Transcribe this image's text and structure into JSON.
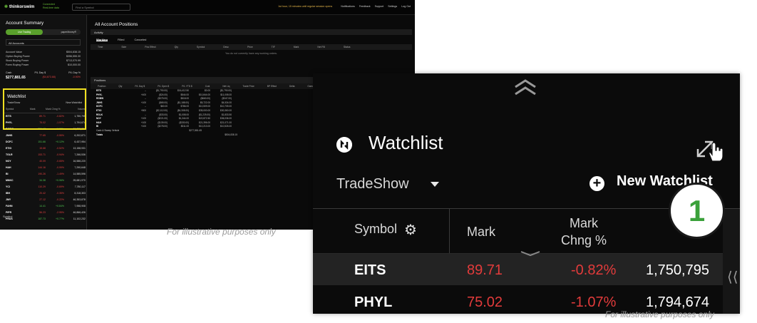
{
  "app": {
    "logo": "thinkorswim",
    "connection_line1": "Connected",
    "connection_line2": "Real-time data",
    "find_symbol_placeholder": "Find a Symbol",
    "top_warning": "1st hour, 15 minutes until regular session opens",
    "top_links": [
      "Notifications",
      "Feedback",
      "Support",
      "Settings",
      "Log Out"
    ]
  },
  "account_summary": {
    "title": "Account Summary",
    "toggle_on": "Live Trading",
    "toggle_off": "paperMoney®",
    "account_select": "All Accounts",
    "rows": [
      {
        "label": "Account Value",
        "value": "$504,838.15"
      },
      {
        "label": "Option Buying Power",
        "value": "$356,555.30"
      },
      {
        "label": "Stock Buying Power",
        "value": "$713,070.99"
      },
      {
        "label": "Forex Buying Power",
        "value": "$10,000.00"
      }
    ],
    "cash_label": "Cash",
    "cash_value": "$277,881.65",
    "pl_day_label": "P/L Day $",
    "pl_day_value": "($4,673.68)",
    "pl_day_pct_label": "P/L Day %",
    "pl_day_pct_value": "-0.90%"
  },
  "watchlist_small": {
    "title": "Watchlist",
    "list_name": "TradeShow",
    "new_watchlist": "New Watchlist",
    "columns": [
      "Symbol",
      "Mark",
      "Mark Chng %",
      "Volume"
    ],
    "rows": [
      {
        "symbol": "EITS",
        "mark": "89.71",
        "chg": "-0.82%",
        "vol": "1,750,795",
        "dir": "down"
      },
      {
        "symbol": "PHYL",
        "mark": "75.02",
        "chg": "-1.07%",
        "vol": "1,794,674",
        "dir": "down"
      },
      {
        "symbol": "RGBW",
        "mark": "256.17",
        "chg": "+0.33%",
        "vol": "10,833,884",
        "dir": "up"
      },
      {
        "symbol": "JNHS",
        "mark": "77.65",
        "chg": "-0.55%",
        "vol": "6,202,871",
        "dir": "down"
      },
      {
        "symbol": "DCFC",
        "mark": "151.66",
        "chg": "+0.12%",
        "vol": "6,437,954",
        "dir": "up"
      },
      {
        "symbol": "ETIO",
        "mark": "15.68",
        "chg": "-0.52%",
        "vol": "13,158,931",
        "dir": "down"
      },
      {
        "symbol": "TGLR",
        "mark": "153.71",
        "chg": "-0.94%",
        "vol": "7,266,536",
        "dir": "down"
      },
      {
        "symbol": "NOY",
        "mark": "40.09",
        "chg": "-0.65%",
        "vol": "16,588,220",
        "dir": "down"
      },
      {
        "symbol": "HAH",
        "mark": "144.16",
        "chg": "-0.99%",
        "vol": "7,290,648",
        "dir": "down"
      },
      {
        "symbol": "BI",
        "mark": "190.26",
        "chg": "-1.49%",
        "vol": "14,585,596",
        "dir": "down"
      },
      {
        "symbol": "MNKC",
        "mark": "34.38",
        "chg": "+0.96%",
        "vol": "25,681,970",
        "dir": "up"
      },
      {
        "symbol": "YCI",
        "mark": "110.29",
        "chg": "-0.69%",
        "vol": "7,780,117",
        "dir": "down"
      },
      {
        "symbol": "IBH",
        "mark": "20.42",
        "chg": "-0.35%",
        "vol": "8,318,303",
        "dir": "down"
      },
      {
        "symbol": "JMY",
        "mark": "27.12",
        "chg": "-0.22%",
        "vol": "46,353,878",
        "dir": "down"
      },
      {
        "symbol": "FAHN",
        "mark": "14.41",
        "chg": "+0.84%",
        "vol": "7,958,908",
        "dir": "up"
      },
      {
        "symbol": "PIPR",
        "mark": "56.23",
        "chg": "-2.95%",
        "vol": "46,866,426",
        "dir": "down"
      },
      {
        "symbol": "PRUS",
        "mark": "187.73",
        "chg": "+0.77%",
        "vol": "11,102,232",
        "dir": "up"
      }
    ],
    "footer": "Symbol"
  },
  "positions_pane": {
    "title": "All Account Positions",
    "activity_label": "Activity",
    "tabs": [
      "Working",
      "Filled",
      "Canceled"
    ],
    "order_columns": [
      "Time",
      "Side",
      "Pos Effect",
      "Qty",
      "Symbol",
      "Desc",
      "Price",
      "TIF",
      "Mark",
      "Net Fill",
      "Status"
    ],
    "no_orders": "You do not currently have any working orders.",
    "positions_label": "Positions",
    "position_columns": [
      "Position",
      "Qty",
      "P/L Day $",
      "P/L Open $",
      "P/L YTD $",
      "Cost",
      "Net Liq",
      "Trade Price",
      "BP Effect",
      "Delta",
      "Gamma",
      "Theta",
      "Vega"
    ],
    "positions": [
      {
        "symbol": "EITS",
        "qty": "--",
        "pl_day": "($1,790.00)",
        "pl_open": "$16,412.50",
        "cost": "$0.00",
        "net_liq": "($1,790.00)"
      },
      {
        "symbol": "PHYL",
        "qty": "+400",
        "pl_day": "($24.00)",
        "pl_open": "$544.00",
        "cost": "$10,844.00",
        "net_liq": "$11,008.00"
      },
      {
        "symbol": "RGBW",
        "qty": "--",
        "pl_day": "($375.00)",
        "pl_open": "$518.00",
        "cost": "($660.00)",
        "net_liq": "($347.00)"
      },
      {
        "symbol": "JNHS",
        "qty": "+100",
        "pl_day": "($65.00)",
        "pl_open": "($1,188.00)",
        "cost": "$5,722.00",
        "net_liq": "$4,534.00"
      },
      {
        "symbol": "DCFC",
        "qty": "--",
        "pl_day": "$60.00",
        "pl_open": "$786.00",
        "cost": "$10,509.00",
        "net_liq": "$10,705.00"
      },
      {
        "symbol": "ETIO",
        "qty": "+800",
        "pl_day": "($2,112.00)",
        "pl_open": "($4,308.00)",
        "cost": "$35,000.00",
        "net_liq": "$30,360.00"
      },
      {
        "symbol": "RGLK",
        "qty": "--",
        "pl_day": "($33.00)",
        "pl_open": "$1,008.00",
        "cost": "($1,225.00)",
        "net_liq": "$1,833.50"
      },
      {
        "symbol": "NOY",
        "qty": "+100",
        "pl_day": "($221.00)",
        "pl_open": "$1,344.00",
        "cost": "$22,872.50",
        "net_liq": "$36,036.00"
      },
      {
        "symbol": "HAH",
        "qty": "+100",
        "pl_day": "($139.00)",
        "pl_open": "($330.00)",
        "cost": "$21,396.00",
        "net_liq": "$21,071.00"
      },
      {
        "symbol": "BI",
        "qty": "+100",
        "pl_day": "($278.00)",
        "pl_open": "$311.00",
        "cost": "$10,213.00",
        "net_liq": "$10,526.00"
      }
    ],
    "cash_label": "Cash & Sweep Vehicle",
    "cash_value": "$277,881.65",
    "totals_label": "Totals",
    "totals_net_liq": "$504,838.15"
  },
  "zoom": {
    "title": "Watchlist",
    "list_name": "TradeShow",
    "new_watchlist": "New Watchlist",
    "col_symbol": "Symbol",
    "col_mark": "Mark",
    "col_chg_line1": "Mark",
    "col_chg_line2": "Chng %",
    "col_vol": "V",
    "badge": "1",
    "rows": [
      {
        "symbol": "EITS",
        "mark": "89.71",
        "chg": "-0.82%",
        "vol": "1,750,795"
      },
      {
        "symbol": "PHYL",
        "mark": "75.02",
        "chg": "-1.07%",
        "vol": "1,794,674"
      }
    ],
    "side_chevron": "⟨⟨"
  },
  "captions": {
    "small": "For illustrative purposes only",
    "large": "For illustrative purposes only"
  },
  "colors": {
    "accent_green": "#5aa02c",
    "down_red": "#e23b3b",
    "up_green": "#4fc24f",
    "highlight": "#f0e020"
  }
}
